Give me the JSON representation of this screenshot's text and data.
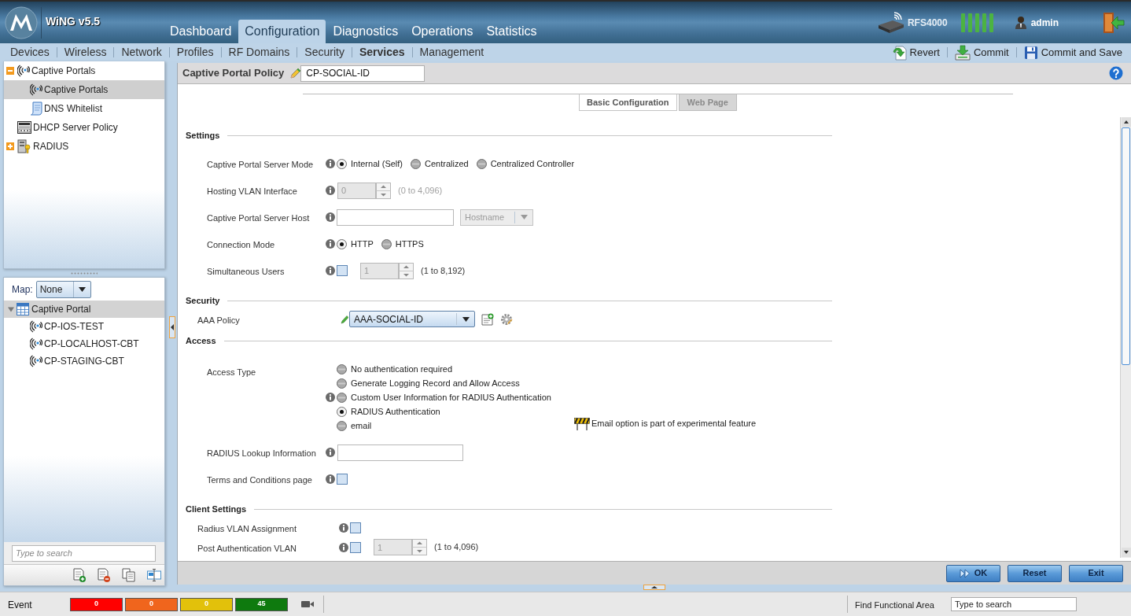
{
  "header": {
    "product": "WiNG v5.5",
    "tabs": [
      {
        "label": "Dashboard",
        "selected": false
      },
      {
        "label": "Configuration",
        "selected": true
      },
      {
        "label": "Diagnostics",
        "selected": false
      },
      {
        "label": "Operations",
        "selected": false
      },
      {
        "label": "Statistics",
        "selected": false
      }
    ],
    "device": "RFS4000",
    "user": "admin"
  },
  "subnav": {
    "items": [
      {
        "label": "Devices",
        "selected": false
      },
      {
        "label": "Wireless",
        "selected": false
      },
      {
        "label": "Network",
        "selected": false
      },
      {
        "label": "Profiles",
        "selected": false
      },
      {
        "label": "RF Domains",
        "selected": false
      },
      {
        "label": "Security",
        "selected": false
      },
      {
        "label": "Services",
        "selected": true
      },
      {
        "label": "Management",
        "selected": false
      }
    ],
    "actions": [
      {
        "label": "Revert",
        "kind": "revert"
      },
      {
        "label": "Commit",
        "kind": "commit"
      },
      {
        "label": "Commit and Save",
        "kind": "save"
      }
    ]
  },
  "tree": [
    {
      "label": "Captive Portals",
      "kind": "portal",
      "expanded": true,
      "selected": false,
      "children": [
        {
          "label": "Captive Portals",
          "kind": "portal",
          "selected": true
        },
        {
          "label": "DNS Whitelist",
          "kind": "document",
          "selected": false
        }
      ]
    },
    {
      "label": "DHCP Server Policy",
      "kind": "server",
      "selected": false
    },
    {
      "label": "RADIUS",
      "kind": "radius",
      "expanded": false,
      "selected": false
    }
  ],
  "map_panel": {
    "label": "Map:",
    "value": "None",
    "group": {
      "label": "Captive Portal",
      "expanded": true,
      "children": [
        {
          "label": "CP-IOS-TEST",
          "kind": "portal",
          "selected": false
        },
        {
          "label": "CP-LOCALHOST-CBT",
          "kind": "portal",
          "selected": false
        },
        {
          "label": "CP-STAGING-CBT",
          "kind": "portal",
          "selected": false
        }
      ]
    },
    "search": {
      "placeholder": "Type to search"
    }
  },
  "policy": {
    "title": "Captive Portal Policy",
    "name": "CP-SOCIAL-ID",
    "tabs": [
      {
        "label": "Basic Configuration",
        "selected": true
      },
      {
        "label": "Web Page",
        "selected": false
      }
    ],
    "sections": [
      {
        "title": "Settings",
        "kind": "indented",
        "rows": [
          {
            "kind": "radio",
            "label": "Captive Portal Server Mode",
            "info": true,
            "options": [
              {
                "label": "Internal (Self)",
                "selected": true
              },
              {
                "label": "Centralized",
                "selected": false
              },
              {
                "label": "Centralized Controller",
                "selected": false
              }
            ]
          },
          {
            "kind": "spinner",
            "label": "Hosting VLAN Interface",
            "info": true,
            "disabled": true,
            "value": "0",
            "range": "(0 to 4,096)"
          },
          {
            "kind": "text_select",
            "label": "Captive Portal Server Host",
            "info": true,
            "select": {
              "value": "Hostname",
              "disabled": true
            }
          },
          {
            "kind": "radio",
            "label": "Connection Mode",
            "info": true,
            "options": [
              {
                "label": "HTTP",
                "selected": true
              },
              {
                "label": "HTTPS",
                "selected": false
              }
            ]
          },
          {
            "kind": "check_spinner",
            "label": "Simultaneous Users",
            "info": true,
            "checked": false,
            "value": "1",
            "range": "(1 to 8,192)"
          }
        ]
      },
      {
        "title": "Security",
        "kind": "compact",
        "rows": [
          {
            "kind": "policy_select",
            "label": "AAA Policy",
            "info": false,
            "value": "AAA-SOCIAL-ID"
          }
        ]
      },
      {
        "title": "Access",
        "kind": "indented",
        "rows": [
          {
            "kind": "radio_list",
            "label": "Access Type",
            "info": false,
            "options": [
              {
                "label": "No authentication required",
                "selected": false,
                "info": false
              },
              {
                "label": "Generate Logging Record and Allow Access",
                "selected": false,
                "info": false
              },
              {
                "label": "Custom User Information for RADIUS Authentication",
                "selected": false,
                "info": true
              },
              {
                "label": "RADIUS Authentication",
                "selected": true,
                "info": false
              },
              {
                "label": "email",
                "selected": false,
                "info": false
              }
            ],
            "note": "Email option is part of experimental feature"
          },
          {
            "kind": "text",
            "label": "RADIUS Lookup Information",
            "info": true
          },
          {
            "kind": "checkbox",
            "label": "Terms and Conditions page",
            "info": true,
            "checked": false
          }
        ]
      },
      {
        "title": "Client Settings",
        "kind": "compact",
        "rows": [
          {
            "kind": "checkbox",
            "label": "Radius VLAN Assignment",
            "info": true,
            "checked": false
          },
          {
            "kind": "check_spinner",
            "label": "Post Authentication VLAN",
            "info": true,
            "checked": false,
            "value": "1",
            "range": "(1 to 4,096)"
          }
        ]
      }
    ]
  },
  "buttons": [
    {
      "label": "OK",
      "kind": "ok"
    },
    {
      "label": "Reset",
      "kind": "plain"
    },
    {
      "label": "Exit",
      "kind": "plain"
    }
  ],
  "status_bar": {
    "label": "Event",
    "counts": [
      {
        "value": "0",
        "color": "#ff0000"
      },
      {
        "value": "0",
        "color": "#f0651d"
      },
      {
        "value": "0",
        "color": "#e2c10b"
      },
      {
        "value": "45",
        "color": "#0e7a0e"
      }
    ],
    "find_label": "Find Functional Area",
    "search": {
      "placeholder": "Type to search"
    }
  }
}
